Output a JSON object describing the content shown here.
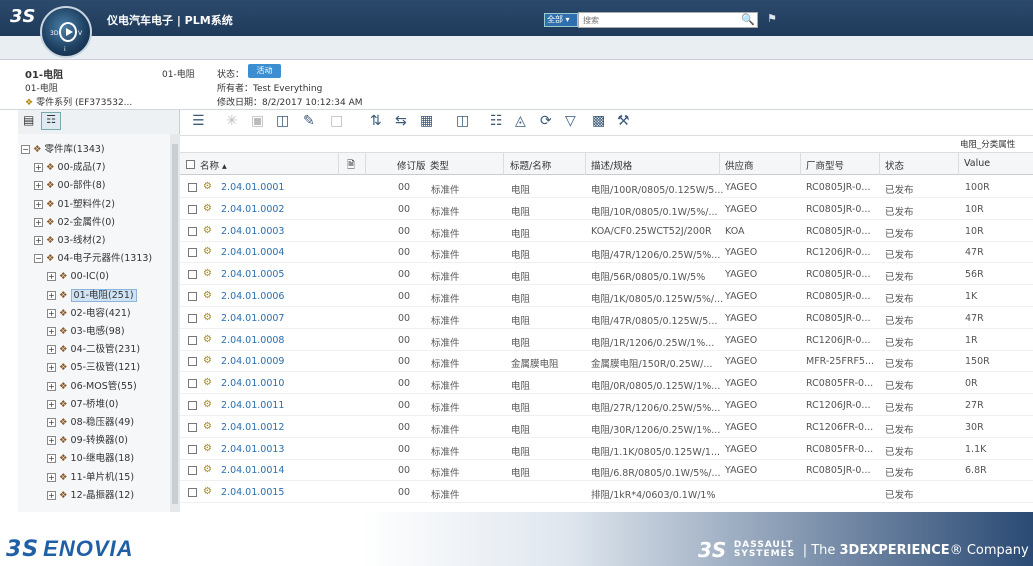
{
  "app": {
    "title": "仪电汽车电子 | PLM系统",
    "logo_text": "3S"
  },
  "compass": {
    "north": "3D",
    "east": "V",
    "south": "i"
  },
  "search": {
    "scope": "全部 ▾",
    "placeholder": "搜索"
  },
  "header": {
    "name": "01-电阻",
    "subtitle": "01-电阻",
    "family": "零件系列 (EF373532...",
    "title2": "01-电阻",
    "state_label": "状态：",
    "state_value": "活动",
    "owner": "所有者：Test Everything",
    "modified": "修改日期：8/2/2017 10:12:34 AM"
  },
  "tree": [
    {
      "label": "零件库(1343)",
      "exp": "−"
    },
    {
      "label": "00-成品(7)",
      "exp": "+"
    },
    {
      "label": "00-部件(8)",
      "exp": "+"
    },
    {
      "label": "01-塑料件(2)",
      "exp": "+"
    },
    {
      "label": "02-金属件(0)",
      "exp": "+"
    },
    {
      "label": "03-线材(2)",
      "exp": "+"
    },
    {
      "label": "04-电子元器件(1313)",
      "exp": "−"
    },
    {
      "label": "00-IC(0)",
      "exp": "+"
    },
    {
      "label": "01-电阻(251)",
      "exp": "+"
    },
    {
      "label": "02-电容(421)",
      "exp": "+"
    },
    {
      "label": "03-电感(98)",
      "exp": "+"
    },
    {
      "label": "04-二极管(231)",
      "exp": "+"
    },
    {
      "label": "05-三极管(121)",
      "exp": "+"
    },
    {
      "label": "06-MOS管(55)",
      "exp": "+"
    },
    {
      "label": "07-桥堆(0)",
      "exp": "+"
    },
    {
      "label": "08-稳压器(49)",
      "exp": "+"
    },
    {
      "label": "09-转换器(0)",
      "exp": "+"
    },
    {
      "label": "10-继电器(18)",
      "exp": "+"
    },
    {
      "label": "11-单片机(15)",
      "exp": "+"
    },
    {
      "label": "12-晶振器(12)",
      "exp": "+"
    }
  ],
  "grid": {
    "group_header": "电阻_分类属性",
    "columns": {
      "name": "名称 ▴",
      "rev": "修订版",
      "type": "类型",
      "title": "标题/名称",
      "desc": "描述/规格",
      "supplier": "供应商",
      "model": "厂商型号",
      "state": "状态",
      "value": "Value"
    },
    "rows": [
      {
        "name": "2.04.01.0001",
        "rev": "00",
        "type": "标准件",
        "title": "电阻",
        "desc": "电阻/100R/0805/0.125W/5...",
        "supplier": "YAGEO",
        "model": "RC0805JR-0...",
        "state": "已发布",
        "value": "100R"
      },
      {
        "name": "2.04.01.0002",
        "rev": "00",
        "type": "标准件",
        "title": "电阻",
        "desc": "电阻/10R/0805/0.1W/5%/...",
        "supplier": "YAGEO",
        "model": "RC0805JR-0...",
        "state": "已发布",
        "value": "10R"
      },
      {
        "name": "2.04.01.0003",
        "rev": "00",
        "type": "标准件",
        "title": "电阻",
        "desc": "KOA/CF0.25WCT52J/200R",
        "supplier": "KOA",
        "model": "RC0805JR-0...",
        "state": "已发布",
        "value": "10R"
      },
      {
        "name": "2.04.01.0004",
        "rev": "00",
        "type": "标准件",
        "title": "电阻",
        "desc": "电阻/47R/1206/0.25W/5%...",
        "supplier": "YAGEO",
        "model": "RC1206JR-0...",
        "state": "已发布",
        "value": "47R"
      },
      {
        "name": "2.04.01.0005",
        "rev": "00",
        "type": "标准件",
        "title": "电阻",
        "desc": "电阻/56R/0805/0.1W/5%",
        "supplier": "YAGEO",
        "model": "RC0805JR-0...",
        "state": "已发布",
        "value": "56R"
      },
      {
        "name": "2.04.01.0006",
        "rev": "00",
        "type": "标准件",
        "title": "电阻",
        "desc": "电阻/1K/0805/0.125W/5%/...",
        "supplier": "YAGEO",
        "model": "RC0805JR-0...",
        "state": "已发布",
        "value": "1K"
      },
      {
        "name": "2.04.01.0007",
        "rev": "00",
        "type": "标准件",
        "title": "电阻",
        "desc": "电阻/47R/0805/0.125W/5...",
        "supplier": "YAGEO",
        "model": "RC0805JR-0...",
        "state": "已发布",
        "value": "47R"
      },
      {
        "name": "2.04.01.0008",
        "rev": "00",
        "type": "标准件",
        "title": "电阻",
        "desc": "电阻/1R/1206/0.25W/1%...",
        "supplier": "YAGEO",
        "model": "RC1206JR-0...",
        "state": "已发布",
        "value": "1R"
      },
      {
        "name": "2.04.01.0009",
        "rev": "00",
        "type": "标准件",
        "title": "金属膜电阻",
        "desc": "金属膜电阻/150R/0.25W/...",
        "supplier": "YAGEO",
        "model": "MFR-25FRF5...",
        "state": "已发布",
        "value": "150R"
      },
      {
        "name": "2.04.01.0010",
        "rev": "00",
        "type": "标准件",
        "title": "电阻",
        "desc": "电阻/0R/0805/0.125W/1%...",
        "supplier": "YAGEO",
        "model": "RC0805FR-0...",
        "state": "已发布",
        "value": "0R"
      },
      {
        "name": "2.04.01.0011",
        "rev": "00",
        "type": "标准件",
        "title": "电阻",
        "desc": "电阻/27R/1206/0.25W/5%...",
        "supplier": "YAGEO",
        "model": "RC1206JR-0...",
        "state": "已发布",
        "value": "27R"
      },
      {
        "name": "2.04.01.0012",
        "rev": "00",
        "type": "标准件",
        "title": "电阻",
        "desc": "电阻/30R/1206/0.25W/1%...",
        "supplier": "YAGEO",
        "model": "RC1206FR-0...",
        "state": "已发布",
        "value": "30R"
      },
      {
        "name": "2.04.01.0013",
        "rev": "00",
        "type": "标准件",
        "title": "电阻",
        "desc": "电阻/1.1K/0805/0.125W/1...",
        "supplier": "YAGEO",
        "model": "RC0805FR-0...",
        "state": "已发布",
        "value": "1.1K"
      },
      {
        "name": "2.04.01.0014",
        "rev": "00",
        "type": "标准件",
        "title": "电阻",
        "desc": "电阻/6.8R/0805/0.1W/5%/...",
        "supplier": "YAGEO",
        "model": "RC0805JR-0...",
        "state": "已发布",
        "value": "6.8R"
      },
      {
        "name": "2.04.01.0015",
        "rev": "00",
        "type": "标准件",
        "title": "",
        "desc": "排阻/1kR*4/0603/0.1W/1%",
        "supplier": "",
        "model": "",
        "state": "已发布",
        "value": ""
      }
    ]
  },
  "footer": {
    "enovia": "ENOVIA",
    "dassault_name_1": "DASSAULT",
    "dassault_name_2": "SYSTEMES",
    "tagline_prefix": "| The ",
    "tagline_bold": "3DEXPERIENCE",
    "tagline_suffix": "® Company"
  },
  "icons": {
    "menu": "menu-icon",
    "gear": "gear-icon",
    "search": "search-icon",
    "tag": "tag-icon",
    "filter": "filter-icon",
    "edit": "pencil-icon",
    "compass": "compass-icon"
  }
}
